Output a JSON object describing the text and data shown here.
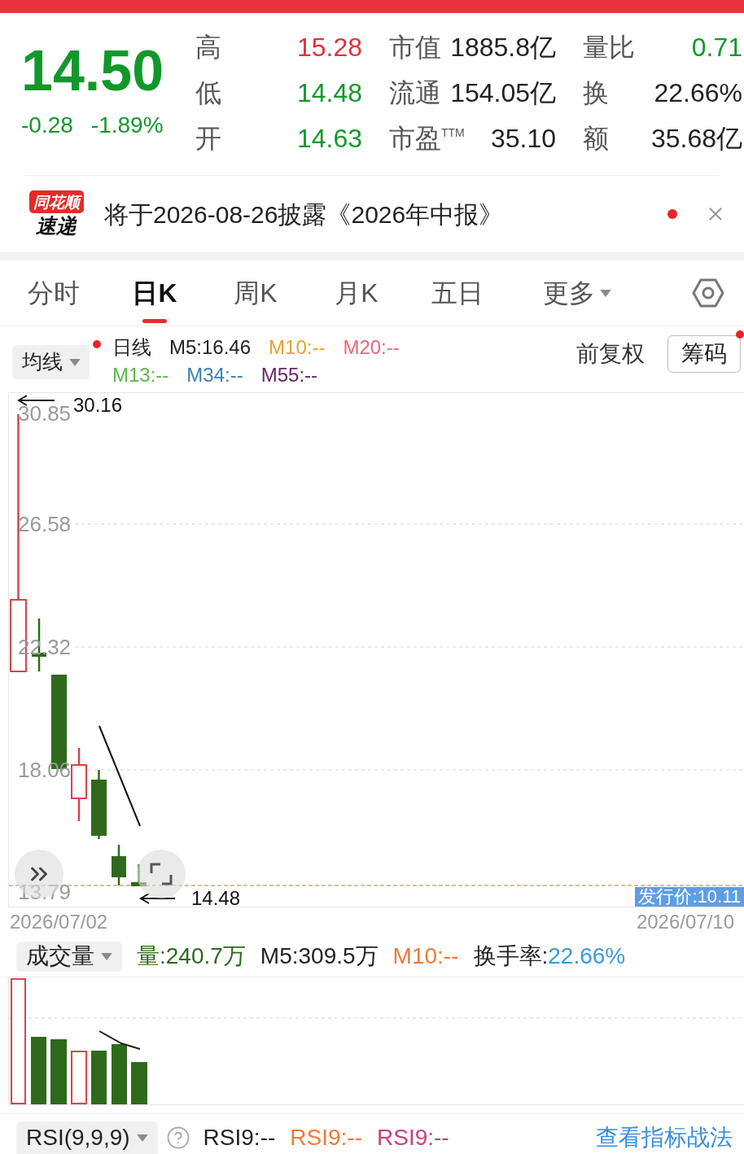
{
  "quote": {
    "price": "14.50",
    "change": "-0.28",
    "change_percent": "-1.89%",
    "color": "#12982a"
  },
  "stats": {
    "rows": [
      {
        "items": [
          {
            "label": "高",
            "value": "15.28",
            "color": "#e0323a"
          },
          {
            "label": "市值",
            "value": "1885.8亿",
            "color": "#222222"
          },
          {
            "label": "量比",
            "value": "0.71",
            "color": "#12982a"
          }
        ]
      },
      {
        "items": [
          {
            "label": "低",
            "value": "14.48",
            "color": "#12982a"
          },
          {
            "label": "流通",
            "value": "154.05亿",
            "color": "#222222"
          },
          {
            "label": "换",
            "value": "22.66%",
            "color": "#222222"
          }
        ]
      },
      {
        "items": [
          {
            "label": "开",
            "value": "14.63",
            "color": "#12982a"
          },
          {
            "label": "市盈$^{TTM}$",
            "value": "35.10",
            "color": "#222222"
          },
          {
            "label": "额",
            "value": "35.68亿",
            "color": "#222222"
          }
        ]
      }
    ]
  },
  "news": {
    "logo_top": "同花顺",
    "logo_bottom": "速递",
    "text": "将于2026-08-26披露《2026年中报》",
    "unread": true
  },
  "tabs": [
    {
      "label": "分时",
      "selected": false,
      "kind": "tab"
    },
    {
      "label": "日K",
      "selected": true,
      "kind": "tab"
    },
    {
      "label": "周K",
      "selected": false,
      "kind": "tab"
    },
    {
      "label": "月K",
      "selected": false,
      "kind": "tab"
    },
    {
      "label": "五日",
      "selected": false,
      "kind": "tab"
    },
    {
      "label": "更多",
      "selected": false,
      "kind": "menu"
    }
  ],
  "legend": {
    "indicator": "均线",
    "dot": true,
    "period": "日线",
    "rows": [
      {
        "items": [
          {
            "text": "M5:16.46",
            "color": "#222222"
          },
          {
            "text": "M10:--",
            "color": "#e8a32e"
          },
          {
            "text": "M20:--",
            "color": "#e8687a"
          }
        ]
      },
      {
        "items": [
          {
            "text": "M13:--",
            "color": "#5db84a"
          },
          {
            "text": "M34:--",
            "color": "#3b7fb8"
          },
          {
            "text": "M55:--",
            "color": "#6b2566"
          }
        ]
      }
    ],
    "adjustment": "前复权",
    "chips_button": {
      "label": "筹码",
      "dot": true
    }
  },
  "price_chart": {
    "y_labels": [
      "30.85",
      "26.58",
      "22.32",
      "18.06",
      "13.79"
    ],
    "high_marker": "30.16",
    "low_marker": "14.48",
    "issue_price": "发行价:10.11",
    "start_date": "2026/07/02",
    "end_date": "2026/07/10"
  },
  "volume": {
    "indicator": "成交量",
    "items": [
      {
        "text": "量:240.7万",
        "color": "#2e6a1c"
      },
      {
        "text": "M5:309.5万",
        "color": "#222222"
      },
      {
        "text": "M10:--",
        "color": "#ee7a3a"
      }
    ],
    "turnover": {
      "label": "换手率:",
      "value": "22.66%"
    }
  },
  "rsi": {
    "indicator": "RSI(9,9,9)",
    "items": [
      {
        "text": "RSI9:--",
        "color": "#222222"
      },
      {
        "text": "RSI9:--",
        "color": "#ee7a3a"
      },
      {
        "text": "RSI9:--",
        "color": "#c8407c"
      }
    ],
    "link": "查看指标战法"
  }
}
